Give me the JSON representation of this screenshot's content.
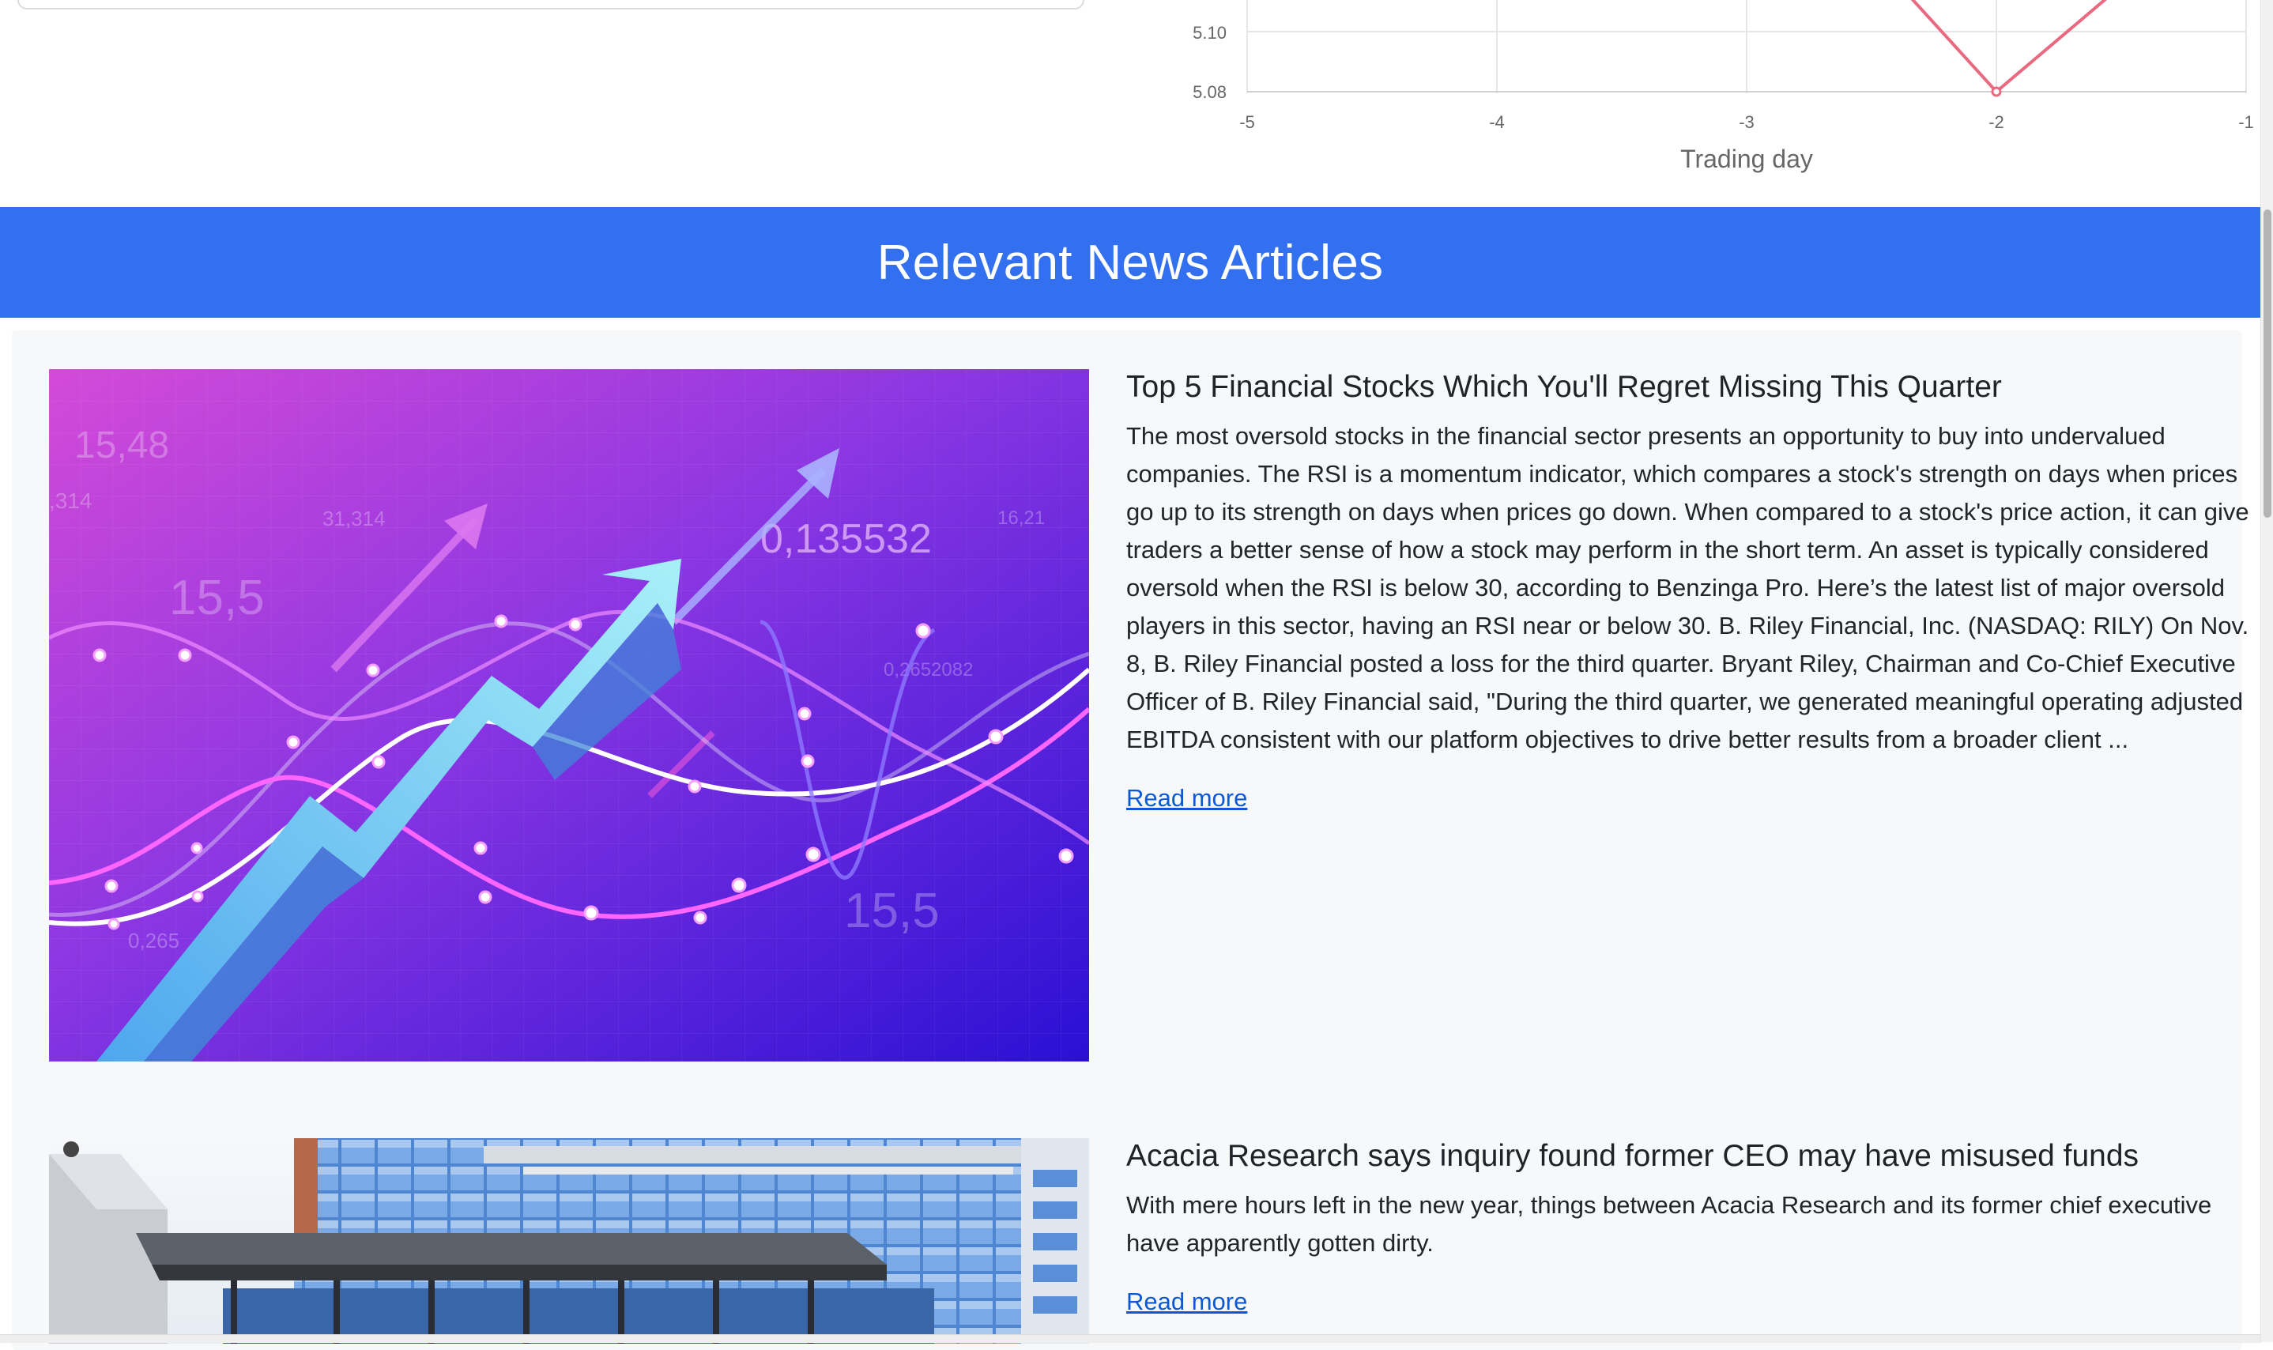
{
  "chart": {
    "y_ticks": [
      "5.10",
      "5.08"
    ],
    "x_ticks": [
      "-5",
      "-4",
      "-3",
      "-2",
      "-1"
    ],
    "x_label": "Trading day",
    "line_color": "#e96a80"
  },
  "chart_data": {
    "type": "line",
    "xlabel": "Trading day",
    "ylabel": "",
    "x": [
      -5,
      -4,
      -3,
      -2,
      -1
    ],
    "xlim": [
      -5,
      -1
    ],
    "y_ticks_visible": [
      5.08,
      5.1
    ],
    "visible_segment": {
      "x": [
        -2.4,
        -2,
        -1.55
      ],
      "y": [
        5.135,
        5.08,
        5.135
      ]
    },
    "grid": true
  },
  "news": {
    "heading": "Relevant News Articles",
    "articles": [
      {
        "title": "Top 5 Financial Stocks Which You'll Regret Missing This Quarter",
        "body": "The most oversold stocks in the financial sector presents an opportunity to buy into undervalued companies. The RSI is a momentum indicator, which compares a stock's strength on days when prices go up to its strength on days when prices go down. When compared to a stock's price action, it can give traders a better sense of how a stock may perform in the short term. An asset is typically considered oversold when the RSI is below 30, according to Benzinga Pro. Here’s the latest list of major oversold players in this sector, having an RSI near or below 30. B. Riley Financial, Inc. (NASDAQ: RILY) On Nov. 8, B. Riley Financial posted a loss for the third quarter. Bryant Riley, Chairman and Co-Chief Executive Officer of B. Riley Financial said, \"During the third quarter, we generated meaningful operating adjusted EBITDA consistent with our platform objectives to drive better results from a broader client ...",
        "read_more": "Read more",
        "image_numbers": [
          "15,48",
          ",314",
          "31,314",
          "15,5",
          "0,135532",
          "16,21",
          "0,2652082",
          "15,5",
          "0,265"
        ]
      },
      {
        "title": "Acacia Research says inquiry found former CEO may have misused funds",
        "body": "With mere hours left in the new year, things between Acacia Research and its former chief executive have apparently gotten dirty.",
        "read_more": "Read more"
      }
    ]
  }
}
